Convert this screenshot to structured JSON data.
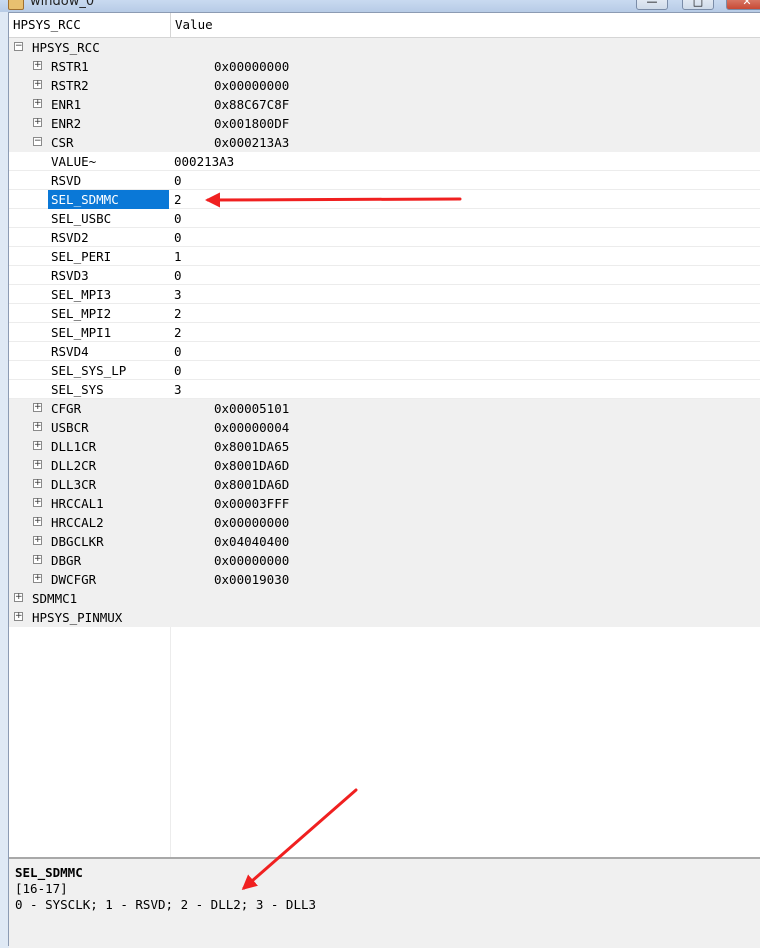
{
  "window": {
    "title": "window_0"
  },
  "header": {
    "col_name": "HPSYS_RCC",
    "col_value": "Value"
  },
  "tree": {
    "root": {
      "label": "HPSYS_RCC",
      "expanded": true
    },
    "registers_top": [
      {
        "name": "RSTR1",
        "value": "0x00000000"
      },
      {
        "name": "RSTR2",
        "value": "0x00000000"
      },
      {
        "name": "ENR1",
        "value": "0x88C67C8F"
      },
      {
        "name": "ENR2",
        "value": "0x001800DF"
      }
    ],
    "csr": {
      "name": "CSR",
      "value": "0x000213A3",
      "fields": [
        {
          "name": "VALUE~",
          "value": "000213A3"
        },
        {
          "name": "RSVD",
          "value": "0"
        },
        {
          "name": "SEL_SDMMC",
          "value": "2",
          "selected": true
        },
        {
          "name": "SEL_USBC",
          "value": "0"
        },
        {
          "name": "RSVD2",
          "value": "0"
        },
        {
          "name": "SEL_PERI",
          "value": "1"
        },
        {
          "name": "RSVD3",
          "value": "0"
        },
        {
          "name": "SEL_MPI3",
          "value": "3"
        },
        {
          "name": "SEL_MPI2",
          "value": "2"
        },
        {
          "name": "SEL_MPI1",
          "value": "2"
        },
        {
          "name": "RSVD4",
          "value": "0"
        },
        {
          "name": "SEL_SYS_LP",
          "value": "0"
        },
        {
          "name": "SEL_SYS",
          "value": "3"
        }
      ]
    },
    "registers_bottom": [
      {
        "name": "CFGR",
        "value": "0x00005101"
      },
      {
        "name": "USBCR",
        "value": "0x00000004"
      },
      {
        "name": "DLL1CR",
        "value": "0x8001DA65"
      },
      {
        "name": "DLL2CR",
        "value": "0x8001DA6D"
      },
      {
        "name": "DLL3CR",
        "value": "0x8001DA6D"
      },
      {
        "name": "HRCCAL1",
        "value": "0x00003FFF"
      },
      {
        "name": "HRCCAL2",
        "value": "0x00000000"
      },
      {
        "name": "DBGCLKR",
        "value": "0x04040400"
      },
      {
        "name": "DBGR",
        "value": "0x00000000"
      },
      {
        "name": "DWCFGR",
        "value": "0x00019030"
      }
    ],
    "peripherals": [
      {
        "label": "SDMMC1"
      },
      {
        "label": "HPSYS_PINMUX"
      }
    ]
  },
  "details": {
    "field_name": "SEL_SDMMC",
    "bits": "[16-17]",
    "description": "0 - SYSCLK; 1 - RSVD; 2 - DLL2; 3 - DLL3"
  },
  "colors": {
    "selection": "#0a78d7",
    "annotation_arrow": "#f02020"
  },
  "icons": {
    "collapsed": "plus-box-icon",
    "expanded": "minus-box-icon"
  }
}
